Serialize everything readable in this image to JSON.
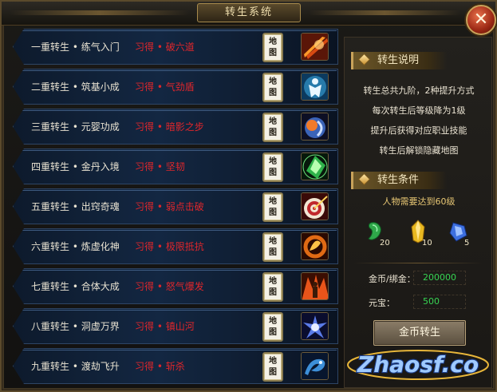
{
  "window": {
    "title": "转生系统",
    "close_label": "✕"
  },
  "rows": [
    {
      "name": "一重转生 • 练气入门",
      "skill": "习得 • 破六道",
      "map_label": [
        "地",
        "图"
      ],
      "icon": "fire-slash-skill-icon",
      "icon_color": "#d84a12"
    },
    {
      "name": "二重转生 • 筑基小成",
      "skill": "习得 • 气劲盾",
      "map_label": [
        "地",
        "图"
      ],
      "icon": "shield-figure-skill-icon",
      "icon_color": "#3aa6e0"
    },
    {
      "name": "三重转生 • 元婴功成",
      "skill": "习得 • 暗影之步",
      "map_label": [
        "地",
        "图"
      ],
      "icon": "shadow-step-skill-icon",
      "icon_color": "#3a63b8"
    },
    {
      "name": "四重转生 • 金丹入境",
      "skill": "习得 • 坚韧",
      "map_label": [
        "地",
        "图"
      ],
      "icon": "green-gem-skill-icon",
      "icon_color": "#2fb24a"
    },
    {
      "name": "五重转生 • 出窍奇魂",
      "skill": "习得 • 弱点击破",
      "map_label": [
        "地",
        "图"
      ],
      "icon": "target-skill-icon",
      "icon_color": "#c0282c"
    },
    {
      "name": "六重转生 • 炼虚化神",
      "skill": "习得 • 极限抵抗",
      "map_label": [
        "地",
        "图"
      ],
      "icon": "flame-ring-skill-icon",
      "icon_color": "#e06a14"
    },
    {
      "name": "七重转生 • 合体大成",
      "skill": "习得 • 怒气爆发",
      "map_label": [
        "地",
        "图"
      ],
      "icon": "rage-figure-skill-icon",
      "icon_color": "#e8541a"
    },
    {
      "name": "八重转生 • 洞虚万界",
      "skill": "习得 • 镇山河",
      "map_label": [
        "地",
        "图"
      ],
      "icon": "blue-burst-skill-icon",
      "icon_color": "#5a7be8"
    },
    {
      "name": "九重转生 • 渡劫飞升",
      "skill": "习得 • 斩杀",
      "map_label": [
        "地",
        "图"
      ],
      "icon": "blue-dragon-skill-icon",
      "icon_color": "#3d8fd8"
    }
  ],
  "panel": {
    "info_title": "转生说明",
    "info_lines": [
      "转生总共九阶，2种提升方式",
      "每次转生后等级降为1级",
      "提升后获得对应职业技能",
      "转生后解锁隐藏地图"
    ],
    "cond_title": "转生条件",
    "cond_req": "人物需要达到60级",
    "items": [
      {
        "icon": "green-jade-item-icon",
        "count": "20",
        "color": "#2fa84a"
      },
      {
        "icon": "yellow-crystal-item-icon",
        "count": "10",
        "color": "#e8b820"
      },
      {
        "icon": "blue-gem-item-icon",
        "count": "5",
        "color": "#3d6fe0"
      }
    ],
    "gold_label": "金币/绑金：",
    "gold_value": "200000",
    "yuanbao_label": "元宝：",
    "yuanbao_value": "500",
    "button_label": "金币转生"
  },
  "watermark": "Zhaosf.co"
}
